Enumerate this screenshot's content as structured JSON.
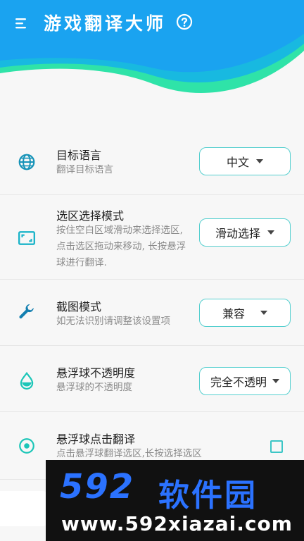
{
  "header": {
    "title": "游戏翻译大师",
    "brand_color": "#1aa3f0",
    "accent_color": "#2fe3a8"
  },
  "settings": [
    {
      "id": "target-language",
      "icon": "globe-icon",
      "title": "目标语言",
      "desc": "翻译目标语言",
      "control": "select",
      "value": "中文"
    },
    {
      "id": "selection-mode",
      "icon": "crop-frame-icon",
      "title": "选区选择模式",
      "desc": "按住空白区域滑动来选择选区, 点击选区拖动来移动, 长按悬浮球进行翻译.",
      "control": "select",
      "value": "滑动选择"
    },
    {
      "id": "screenshot-mode",
      "icon": "wrench-icon",
      "title": "截图模式",
      "desc": "如无法识别请调整该设置项",
      "control": "select",
      "value": "兼容"
    },
    {
      "id": "float-opacity",
      "icon": "drop-icon",
      "title": "悬浮球不透明度",
      "desc": "悬浮球的不透明度",
      "control": "select",
      "value": "完全不透明"
    },
    {
      "id": "float-click-translate",
      "icon": "target-icon",
      "title": "悬浮球点击翻译",
      "desc": "点击悬浮球翻译选区,长按选择选区",
      "control": "checkbox",
      "checked": false
    }
  ],
  "watermark": {
    "brand": "592",
    "brand_suffix": "软件园",
    "url": "www.592xiazai.com"
  }
}
